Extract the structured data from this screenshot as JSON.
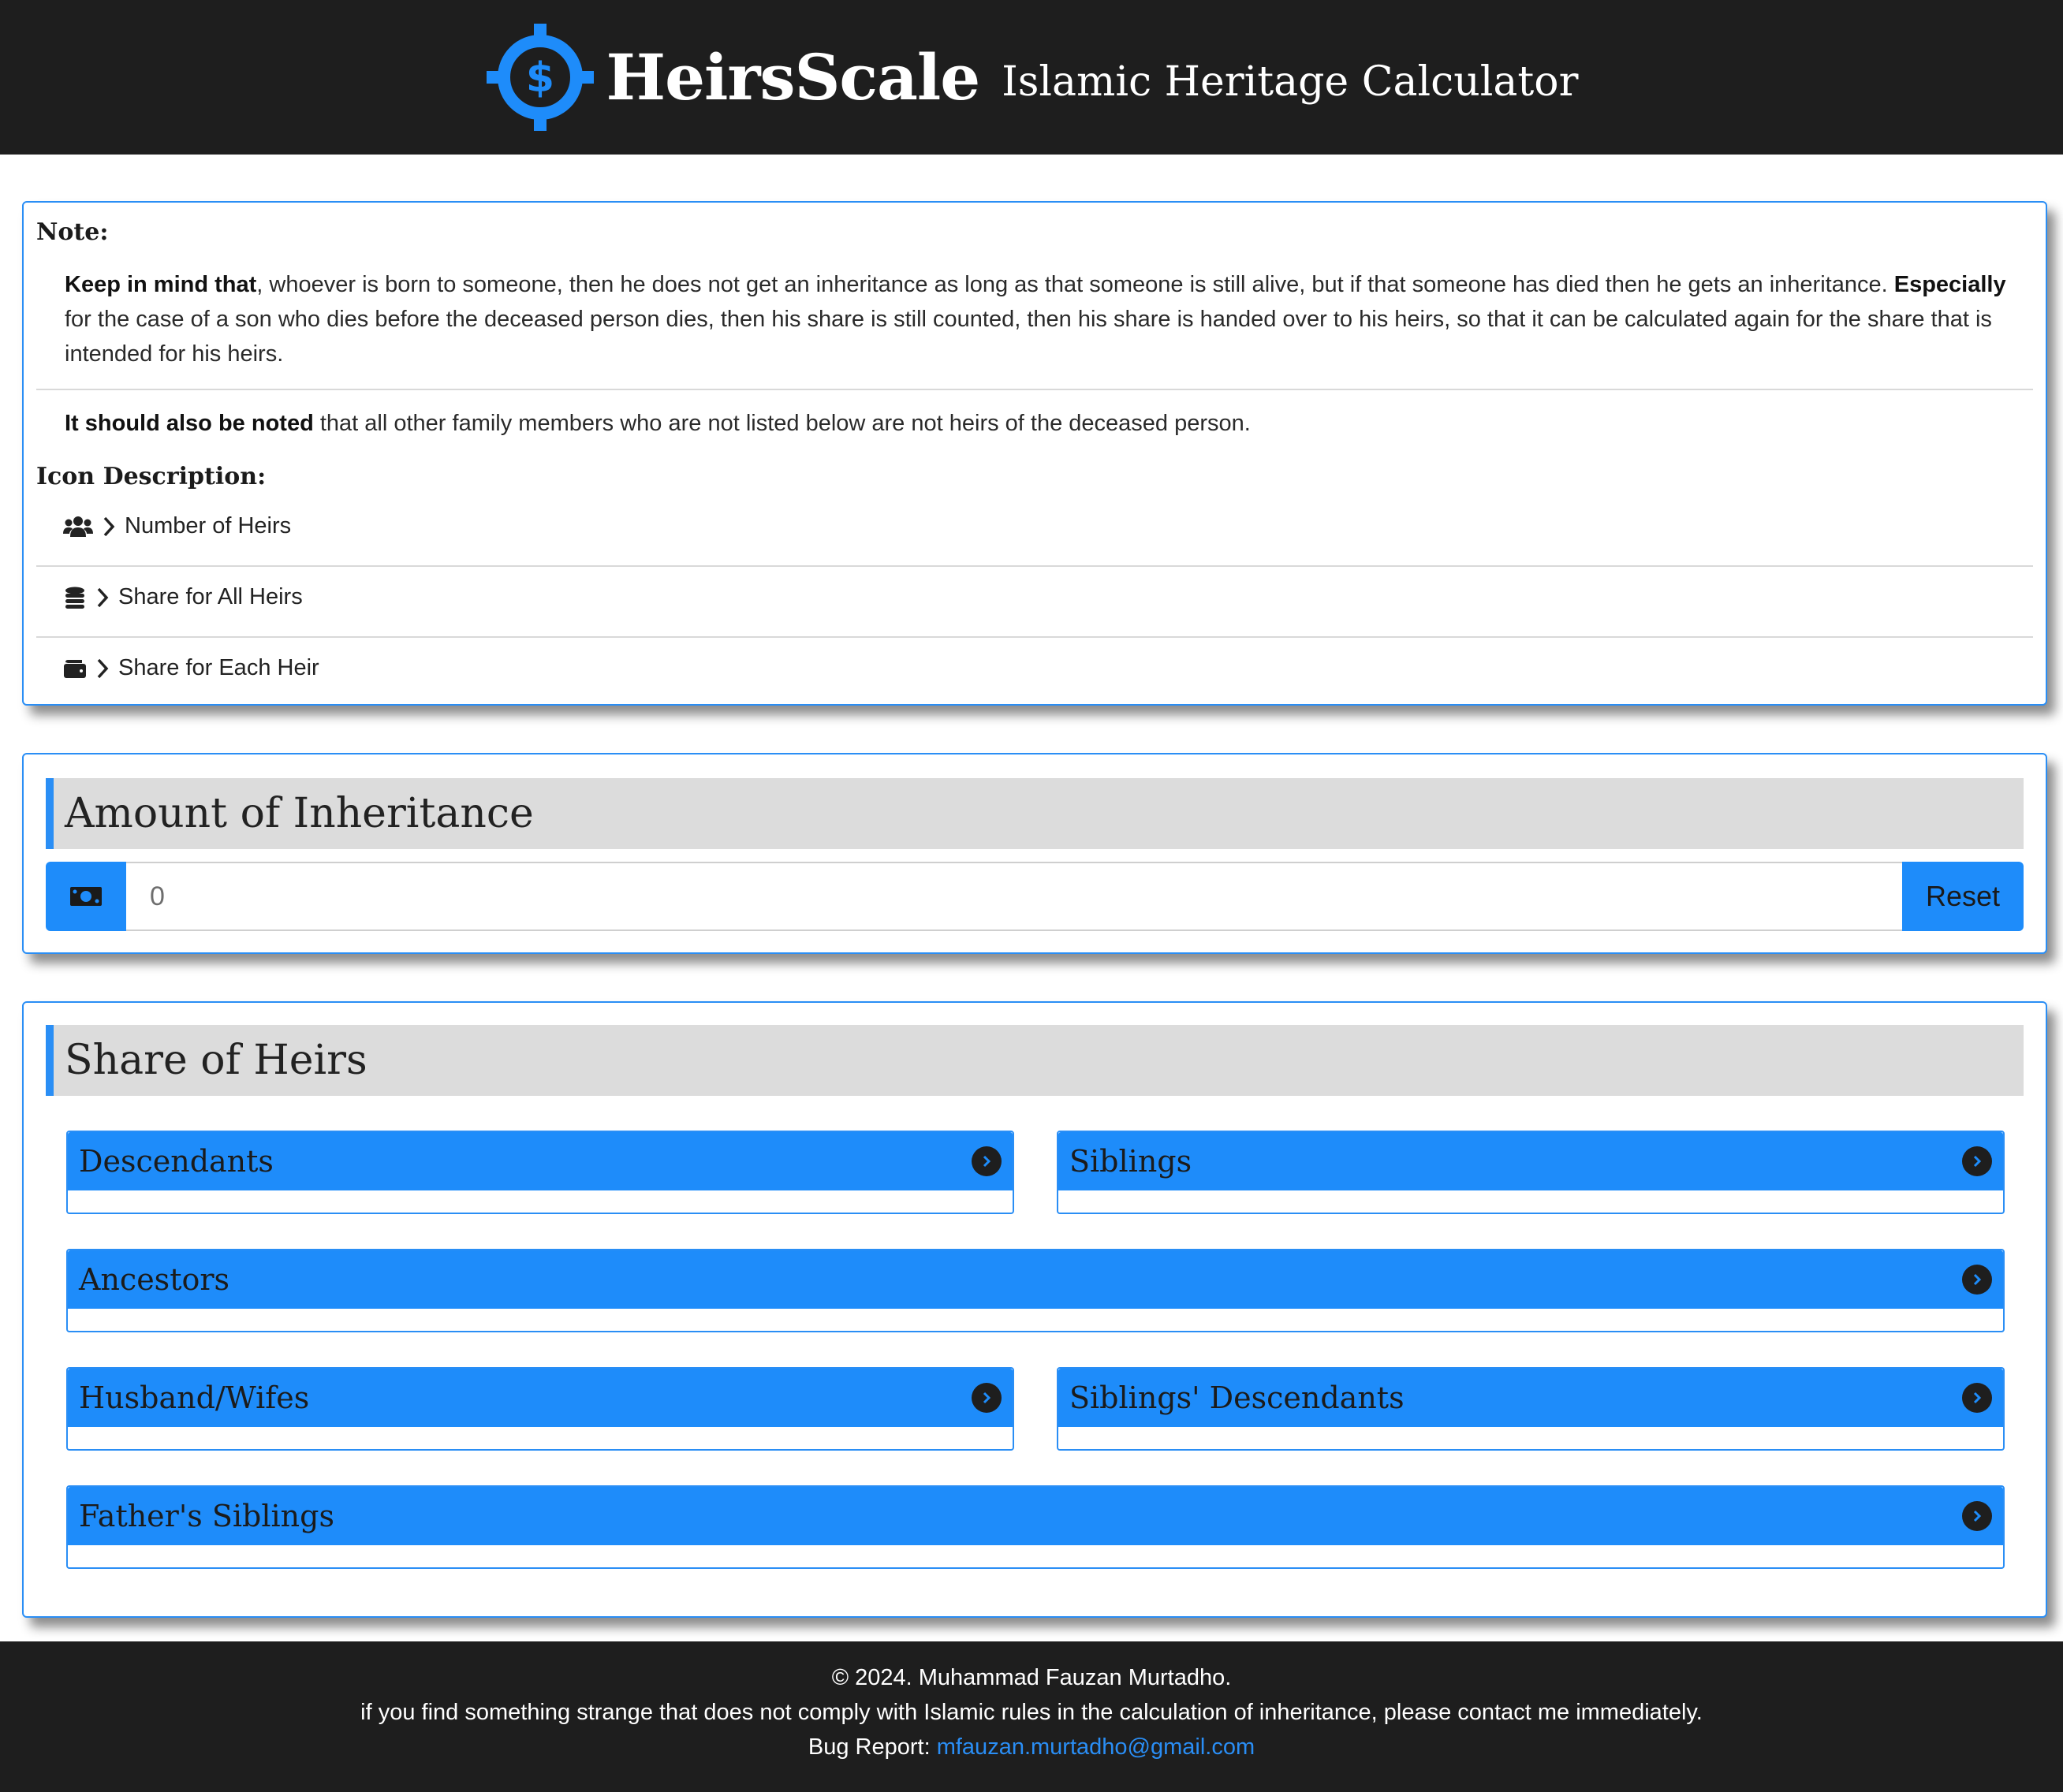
{
  "header": {
    "brand": "HeirsScale",
    "tagline": "Islamic Heritage Calculator",
    "logo_icon": "crosshair-dollar-icon",
    "accent_color": "#1e8cfa"
  },
  "note": {
    "heading": "Note:",
    "para1_lead": "Keep in mind that",
    "para1_text": ", whoever is born to someone, then he does not get an inheritance as long as that someone is still alive, but if that someone has died then he gets an inheritance.",
    "para1_lead2": "Especially",
    "para1_text2": "for the case of a son who dies before the deceased person dies, then his share is still counted, then his share is handed over to his heirs, so that it can be calculated again for the share that is intended for his heirs.",
    "para2_lead": "It should also be noted",
    "para2_text": "that all other family members who are not listed below are not heirs of the deceased person.",
    "icon_heading": "Icon Description:",
    "icons": [
      {
        "icon": "users-icon",
        "label": "Number of Heirs"
      },
      {
        "icon": "coins-icon",
        "label": "Share for All Heirs"
      },
      {
        "icon": "wallet-icon",
        "label": "Share for Each Heir"
      }
    ]
  },
  "amount": {
    "title": "Amount of Inheritance",
    "input_value": "0",
    "money_icon": "money-bill-icon",
    "reset_label": "Reset"
  },
  "share": {
    "title": "Share of Heirs",
    "groups": [
      {
        "label": "Descendants"
      },
      {
        "label": "Siblings"
      },
      {
        "label": "Ancestors"
      },
      {
        "label": "Husband/Wifes"
      },
      {
        "label": "Siblings' Descendants"
      },
      {
        "label": "Father's Siblings"
      }
    ]
  },
  "footer": {
    "copyright": "© 2024. Muhammad Fauzan Murtadho.",
    "message": "if you find something strange that does not comply with Islamic rules in the calculation of inheritance, please contact me immediately.",
    "bug_label": "Bug Report:",
    "email": "mfauzan.murtadho@gmail.com"
  }
}
